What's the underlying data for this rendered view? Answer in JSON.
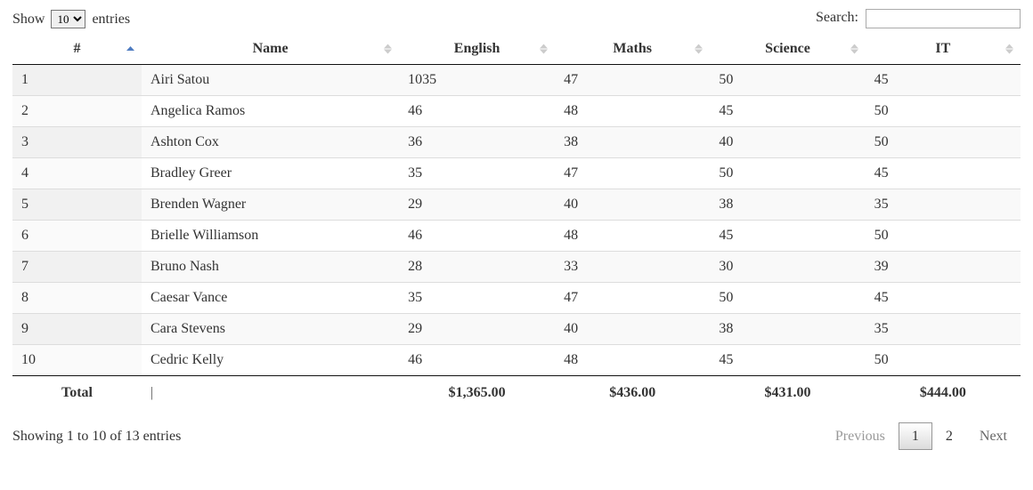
{
  "lengthMenu": {
    "prefix": "Show",
    "suffix": "entries",
    "value": "10"
  },
  "search": {
    "label": "Search:",
    "value": ""
  },
  "columns": {
    "id": "#",
    "name": "Name",
    "english": "English",
    "maths": "Maths",
    "science": "Science",
    "it": "IT"
  },
  "rows": [
    {
      "id": "1",
      "name": "Airi Satou",
      "english": "1035",
      "maths": "47",
      "science": "50",
      "it": "45"
    },
    {
      "id": "2",
      "name": "Angelica Ramos",
      "english": "46",
      "maths": "48",
      "science": "45",
      "it": "50"
    },
    {
      "id": "3",
      "name": "Ashton Cox",
      "english": "36",
      "maths": "38",
      "science": "40",
      "it": "50"
    },
    {
      "id": "4",
      "name": "Bradley Greer",
      "english": "35",
      "maths": "47",
      "science": "50",
      "it": "45"
    },
    {
      "id": "5",
      "name": "Brenden Wagner",
      "english": "29",
      "maths": "40",
      "science": "38",
      "it": "35"
    },
    {
      "id": "6",
      "name": "Brielle Williamson",
      "english": "46",
      "maths": "48",
      "science": "45",
      "it": "50"
    },
    {
      "id": "7",
      "name": "Bruno Nash",
      "english": "28",
      "maths": "33",
      "science": "30",
      "it": "39"
    },
    {
      "id": "8",
      "name": "Caesar Vance",
      "english": "35",
      "maths": "47",
      "science": "50",
      "it": "45"
    },
    {
      "id": "9",
      "name": "Cara Stevens",
      "english": "29",
      "maths": "40",
      "science": "38",
      "it": "35"
    },
    {
      "id": "10",
      "name": "Cedric Kelly",
      "english": "46",
      "maths": "48",
      "science": "45",
      "it": "50"
    }
  ],
  "footer": {
    "totalLabel": "Total",
    "divider": "|",
    "english": "$1,365.00",
    "maths": "$436.00",
    "science": "$431.00",
    "it": "$444.00"
  },
  "info": "Showing 1 to 10 of 13 entries",
  "pagination": {
    "previous": "Previous",
    "next": "Next",
    "pages": [
      "1",
      "2"
    ],
    "active": "1"
  }
}
